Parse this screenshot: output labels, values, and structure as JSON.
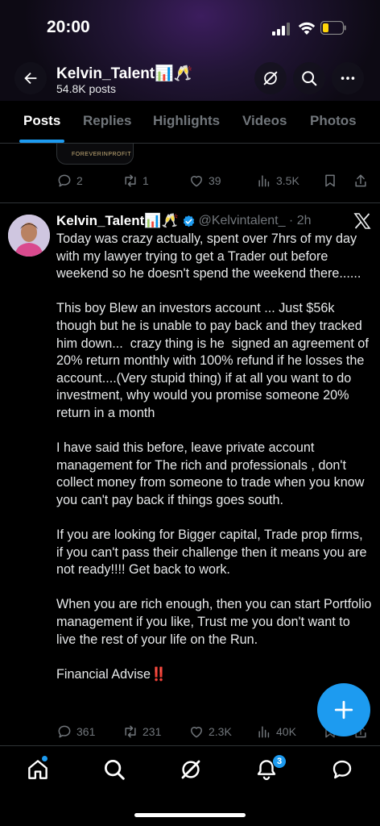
{
  "status_bar": {
    "time": "20:00"
  },
  "profile": {
    "name": "Kelvin_Talent📊🥂",
    "posts_count": "54.8K posts"
  },
  "tabs": [
    {
      "label": "Posts",
      "active": true
    },
    {
      "label": "Replies",
      "active": false
    },
    {
      "label": "Highlights",
      "active": false
    },
    {
      "label": "Videos",
      "active": false
    },
    {
      "label": "Photos",
      "active": false
    }
  ],
  "previous_post": {
    "media_caption": "FOREVERINPROFIT",
    "replies": "2",
    "reposts": "1",
    "likes": "39",
    "views": "3.5K"
  },
  "tweet": {
    "author_name": "Kelvin_Talent📊🥂",
    "handle_time": "@Kelvintalent_ · 2h",
    "text": "Today was crazy actually, spent over 7hrs of my day with my lawyer trying to get a Trader out before weekend so he doesn't spend the weekend there......\n\nThis boy Blew an investors account ... Just $56k though but he is unable to pay back and they tracked him down...  crazy thing is he  signed an agreement of 20% return monthly with 100% refund if he losses the account....(Very stupid thing) if at all you want to do investment, why would you promise someone 20% return in a month\n\nI have said this before, leave private account management for The rich and professionals , don't collect money from someone to trade when you know you can't pay back if things goes south.\n\nIf you are looking for Bigger capital, Trade prop firms, if you can't pass their challenge then it means you are not ready!!!! Get back to work.\n\nWhen you are rich enough, then you can start Portfolio management if you like, Trust me you don't want to live the rest of your life on the Run.\n\nFinancial Advise‼️",
    "replies": "361",
    "reposts": "231",
    "likes": "2.3K",
    "views": "40K"
  },
  "bottom_nav": {
    "notifications_badge": "3"
  },
  "colors": {
    "accent": "#1d9bf0",
    "muted": "#71767b",
    "background": "#000000"
  }
}
